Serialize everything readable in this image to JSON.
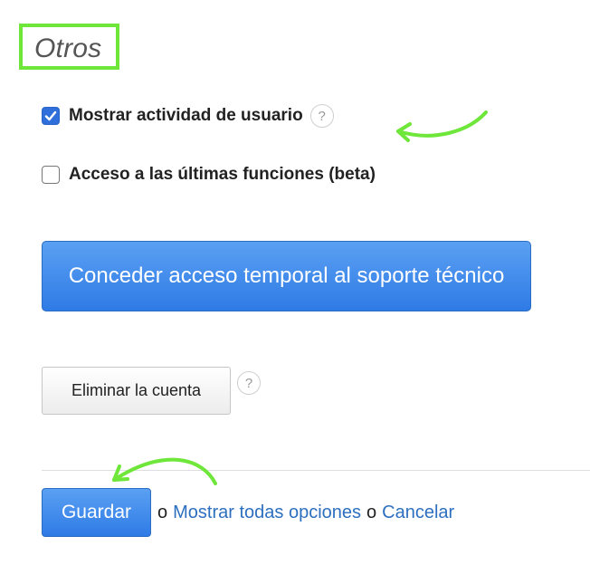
{
  "section": {
    "title": "Otros"
  },
  "options": [
    {
      "label": "Mostrar actividad de usuario",
      "checked": true,
      "help": "?"
    },
    {
      "label": "Acceso a las últimas funciones (beta)",
      "checked": false
    }
  ],
  "support_button": {
    "label": "Conceder acceso temporal al soporte técnico"
  },
  "delete_account": {
    "label": "Eliminar la cuenta",
    "help": "?"
  },
  "footer": {
    "save_label": "Guardar",
    "sep1": "o",
    "show_all_label": "Mostrar todas opciones",
    "sep2": "o",
    "cancel_label": "Cancelar"
  },
  "colors": {
    "accent": "#2f7be6",
    "link": "#2d6fbf",
    "highlight": "#6ee63a"
  }
}
